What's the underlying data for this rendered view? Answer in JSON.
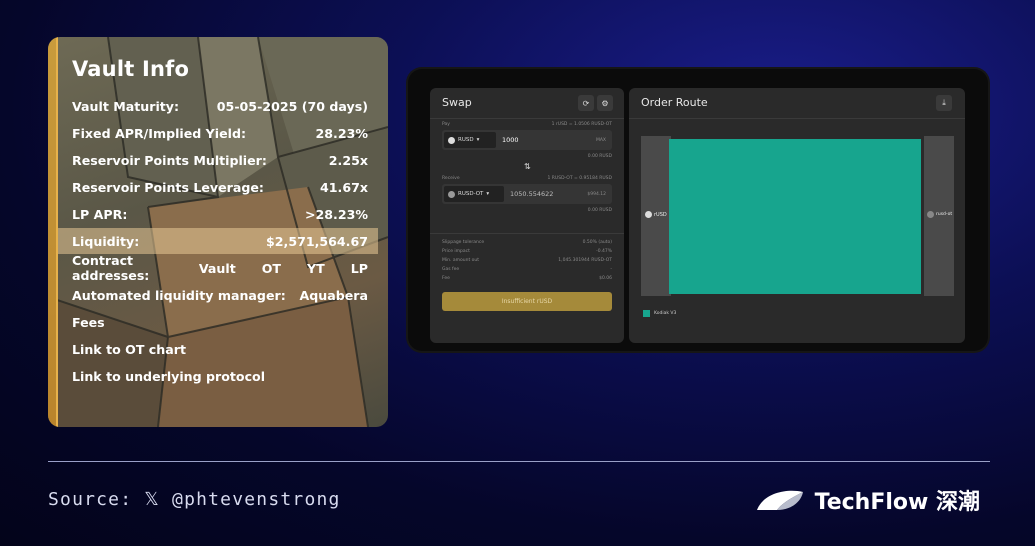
{
  "vault": {
    "title": "Vault Info",
    "rows": [
      {
        "label": "Vault Maturity:",
        "value": "05-05-2025 (70 days)"
      },
      {
        "label": "Fixed APR/Implied Yield:",
        "value": "28.23%"
      },
      {
        "label": "Reservoir Points Multiplier:",
        "value": "2.25x"
      },
      {
        "label": "Reservoir Points Leverage:",
        "value": "41.67x"
      },
      {
        "label": "LP APR:",
        "value": ">28.23%"
      },
      {
        "label": "Liquidity:",
        "value": "$2,571,564.67"
      }
    ],
    "contract": {
      "label": "Contract addresses:",
      "links": [
        "Vault",
        "OT",
        "YT",
        "LP"
      ]
    },
    "manager": {
      "label": "Automated liquidity manager:",
      "value": "Aquabera"
    },
    "links": [
      "Fees",
      "Link to OT chart",
      "Link to underlying protocol"
    ],
    "accent_color": "#c89b3c"
  },
  "swap": {
    "title": "Swap",
    "pay_label": "Pay",
    "pay_rate": "1 rUSD = 1.0506 RUSD-OT",
    "pay_token": "RUSD",
    "pay_amount": "1000",
    "pay_max": "MAX",
    "pay_balance": "0.00 RUSD",
    "receive_label": "Receive",
    "receive_rate": "1 RUSD-OT = 0.95184 RUSD",
    "receive_token": "RUSD-OT",
    "receive_amount": "1050.554622",
    "receive_usd": "$994.12",
    "receive_balance": "0.00 RUSD",
    "details": [
      {
        "label": "Slippage tolerance",
        "value": "0.50% (auto)"
      },
      {
        "label": "Price impact",
        "value": "-0.47%"
      },
      {
        "label": "Min. amount out",
        "value": "1,045.301944 RUSD-OT"
      },
      {
        "label": "Gas fee",
        "value": "-"
      },
      {
        "label": "Fee",
        "value": "$0.06"
      }
    ],
    "submit_label": "Insufficient rUSD",
    "submit_color": "#a58a3a"
  },
  "route": {
    "title": "Order Route",
    "from": "rUSD",
    "to": "rusd-ot",
    "legend": "Kodiak V3",
    "flow_color": "#17a58e"
  },
  "footer": {
    "source": "Source: 𝕏 @phtevenstrong",
    "brand": "TechFlow 深潮"
  }
}
